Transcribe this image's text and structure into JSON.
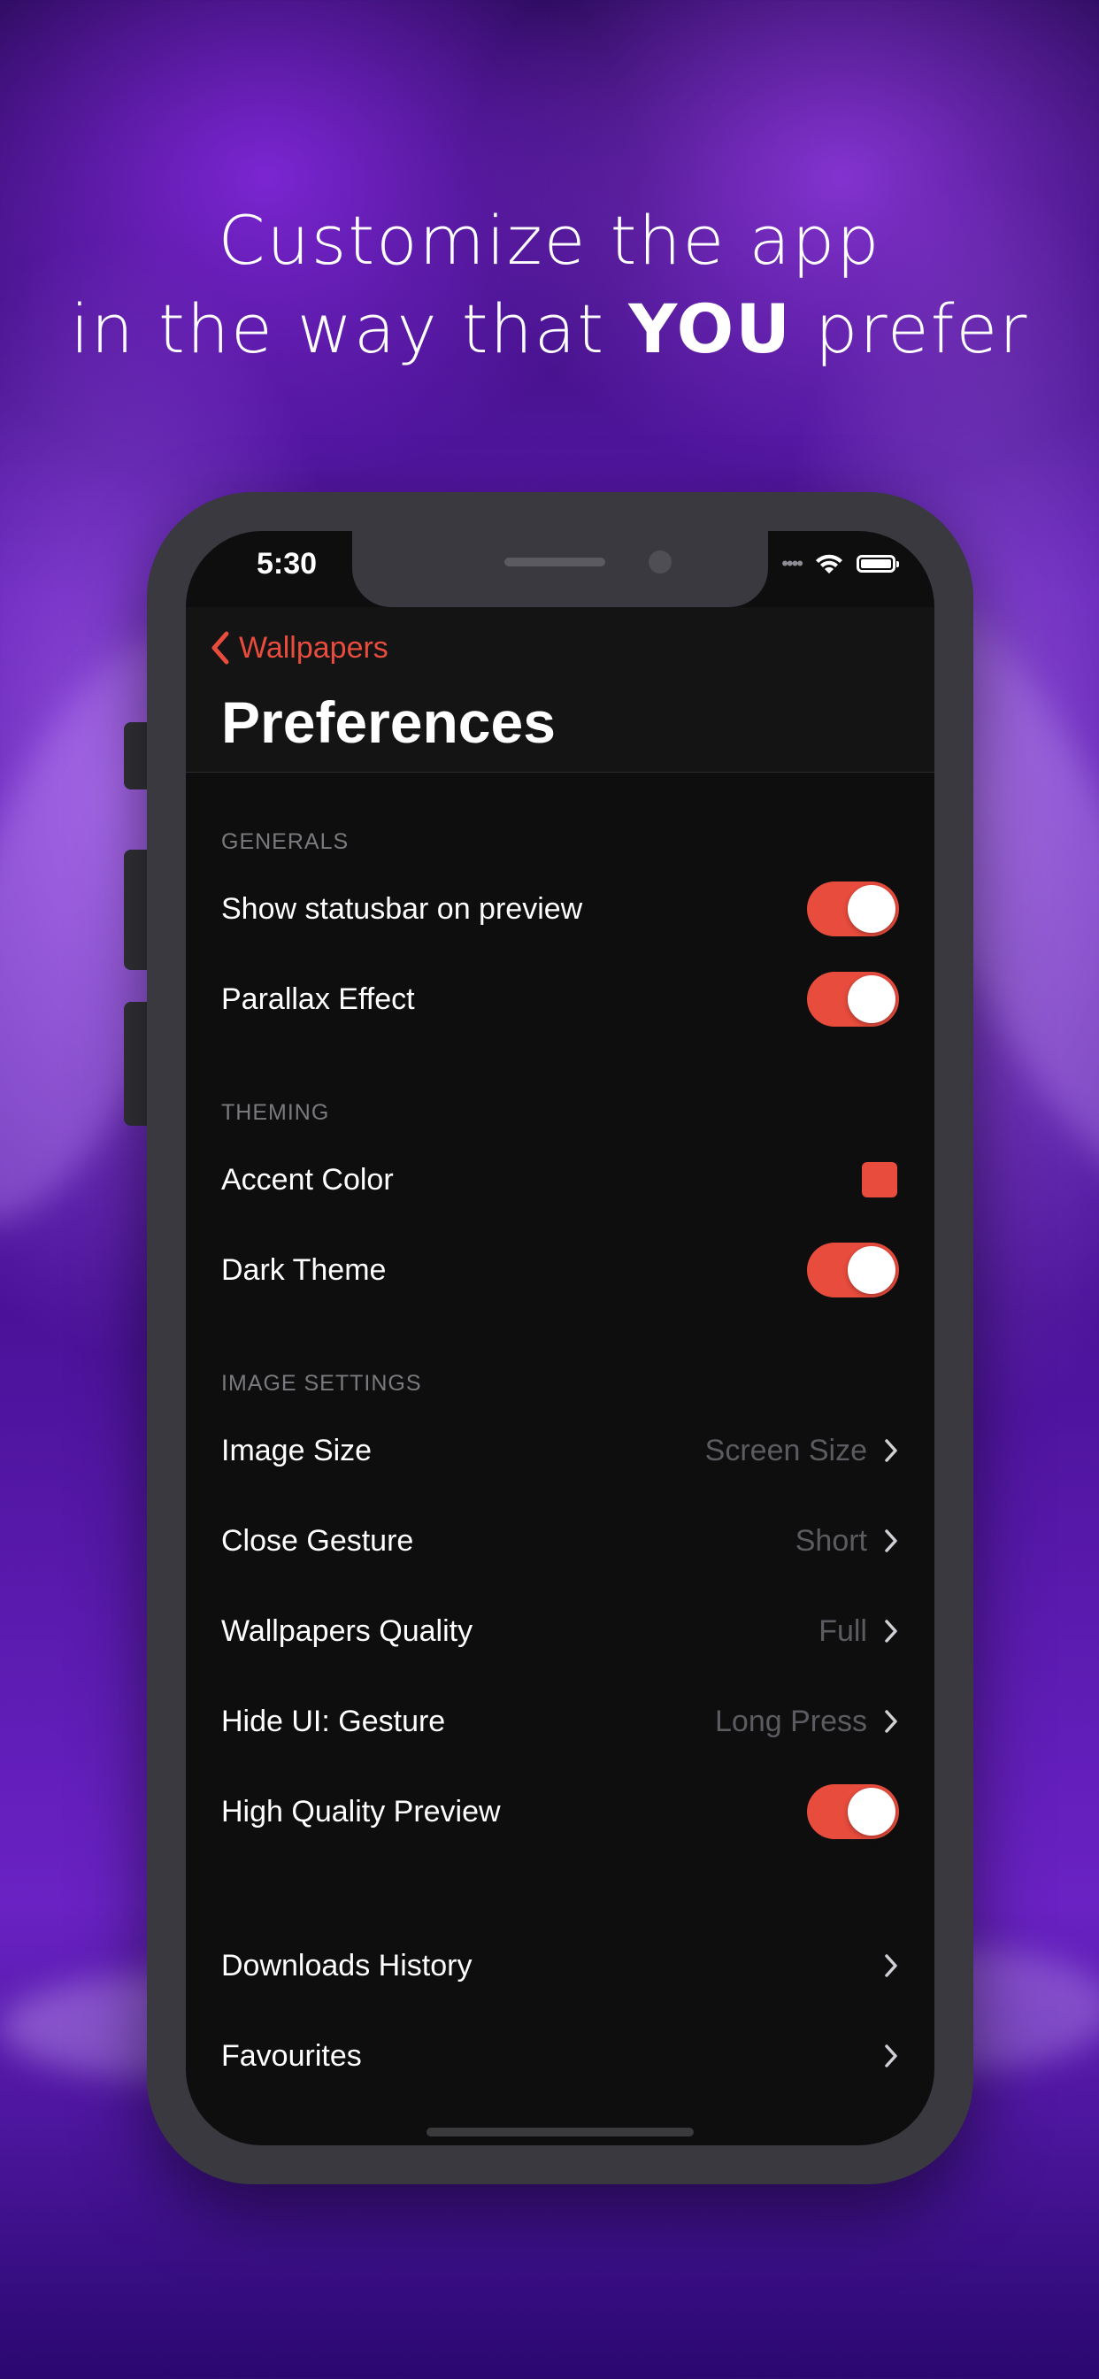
{
  "headline": {
    "line1": "Customize the app",
    "line2_prefix": "in the way that ",
    "line2_bold": "YOU",
    "line2_suffix": " prefer"
  },
  "status_bar": {
    "time": "5:30"
  },
  "nav": {
    "back_label": "Wallpapers",
    "title": "Preferences"
  },
  "colors": {
    "accent": "#e84c3d",
    "background": "#0e0e0f"
  },
  "sections": {
    "generals": {
      "header": "GENERALS",
      "rows": [
        {
          "label": "Show statusbar on preview",
          "toggle_on": true
        },
        {
          "label": "Parallax Effect",
          "toggle_on": true
        }
      ]
    },
    "theming": {
      "header": "THEMING",
      "rows": [
        {
          "label": "Accent Color",
          "swatch": "#e84c3d"
        },
        {
          "label": "Dark Theme",
          "toggle_on": true
        }
      ]
    },
    "image_settings": {
      "header": "IMAGE SETTINGS",
      "rows": [
        {
          "label": "Image Size",
          "value": "Screen Size"
        },
        {
          "label": "Close Gesture",
          "value": "Short"
        },
        {
          "label": "Wallpapers Quality",
          "value": "Full"
        },
        {
          "label": "Hide UI: Gesture",
          "value": "Long Press"
        },
        {
          "label": "High Quality Preview",
          "toggle_on": true
        }
      ]
    },
    "other": {
      "rows": [
        {
          "label": "Downloads History"
        },
        {
          "label": "Favourites"
        }
      ]
    }
  },
  "icons": [
    "back-chevron-icon",
    "wifi-icon",
    "battery-icon",
    "chevron-right-icon"
  ]
}
